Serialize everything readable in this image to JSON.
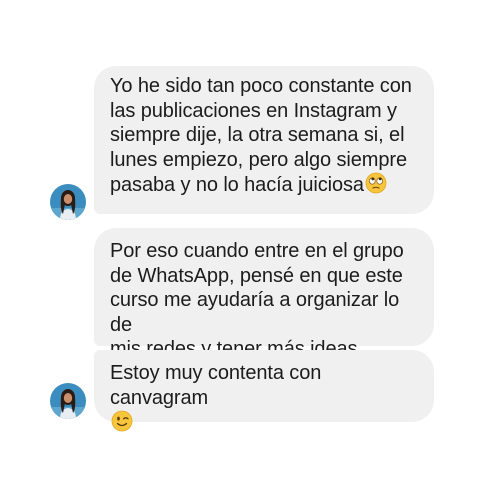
{
  "conversation": {
    "messages": [
      {
        "text": "Yo he sido tan poco constante con\nlas publicaciones en Instagram y\nsiempre dije, la otra semana si, el\nlunes empiezo, pero algo siempre\npasaba y no lo hacía juiciosa",
        "emoji": "rolling-eyes-emoji"
      },
      {
        "text": "Por eso cuando entre en el grupo\nde WhatsApp, pensé en que este\ncurso me ayudaría a organizar lo de\nmis redes y tener más ideas"
      },
      {
        "text": "Estoy muy contenta con canvagram\n",
        "emoji": "winking-face-emoji"
      }
    ]
  },
  "colors": {
    "bubble_background": "#f0f0f0",
    "text": "#1c1c1c",
    "emoji_yellow": "#f7c53c",
    "avatar_background": "#3b8dbf"
  }
}
